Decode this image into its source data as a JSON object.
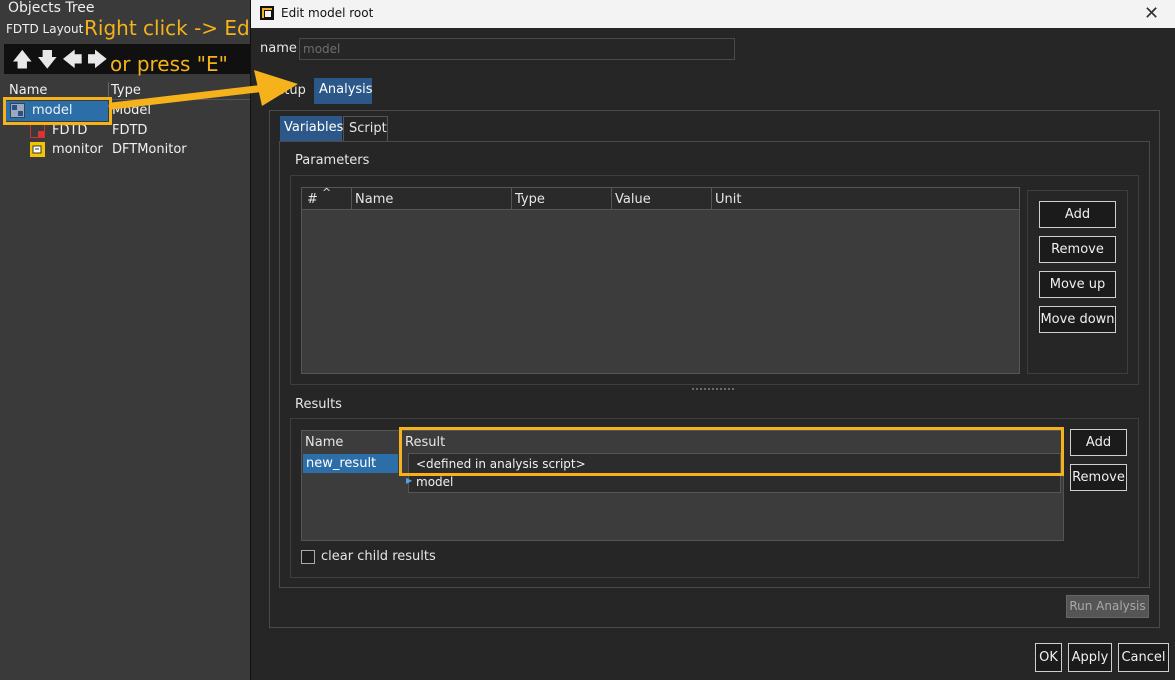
{
  "left": {
    "title": "Objects Tree",
    "layout_label": "FDTD Layout",
    "annotation_line1": "Right click -> Edit,",
    "annotation_line2": "or press \"E\"",
    "columns": {
      "name": "Name",
      "type": "Type"
    },
    "rows": [
      {
        "name": "model",
        "type": "Model",
        "icon": "model-icon"
      },
      {
        "name": "FDTD",
        "type": "FDTD",
        "icon": "fdtd-icon"
      },
      {
        "name": "monitor",
        "type": "DFTMonitor",
        "icon": "monitor-icon"
      }
    ]
  },
  "dialog": {
    "title": "Edit model root",
    "close_symbol": "✕",
    "name_label": "name",
    "name_value": "model",
    "tabs": {
      "setup": "Setup",
      "analysis": "Analysis"
    },
    "subtabs": {
      "variables": "Variables",
      "script": "Script"
    },
    "parameters": {
      "label": "Parameters",
      "columns": [
        "#",
        "Name",
        "Type",
        "Value",
        "Unit"
      ],
      "buttons": {
        "add": "Add",
        "remove": "Remove",
        "move_up": "Move up",
        "move_down": "Move down"
      }
    },
    "results": {
      "label": "Results",
      "columns": {
        "name": "Name",
        "result": "Result"
      },
      "rows": [
        {
          "name": "new_result"
        }
      ],
      "dropdown_options": [
        "<defined in analysis script>",
        "model"
      ],
      "buttons": {
        "add": "Add",
        "remove": "Remove"
      }
    },
    "clear_child_results": "clear child results",
    "run_analysis": "Run Analysis",
    "footer": {
      "ok": "OK",
      "apply": "Apply",
      "cancel": "Cancel"
    }
  },
  "colors": {
    "highlight": "#f5b21b",
    "selection": "#2b6ea8",
    "tab_active": "#2b5888"
  }
}
